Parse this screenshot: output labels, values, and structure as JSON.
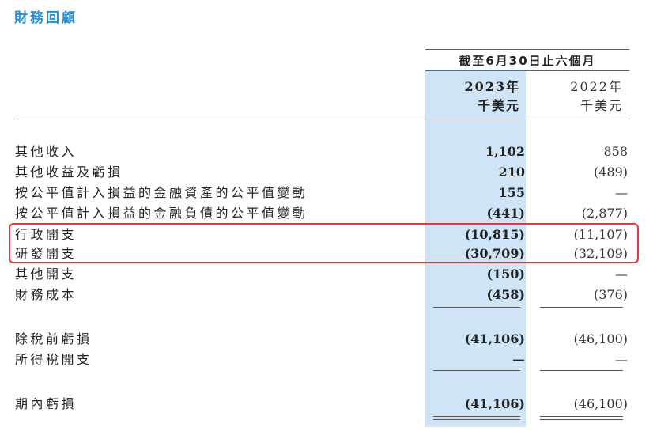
{
  "document": {
    "section_title": "財務回顧",
    "period_header": "截至6月30日止六個月",
    "columns": {
      "current": {
        "year": "2023年",
        "unit": "千美元"
      },
      "previous": {
        "year": "2022年",
        "unit": "千美元"
      }
    },
    "rows": [
      {
        "label": "其他收入",
        "current": "1,102",
        "previous": "858"
      },
      {
        "label": "其他收益及虧損",
        "current": "210",
        "previous": "(489)"
      },
      {
        "label": "按公平值計入損益的金融資產的公平值變動",
        "current": "155",
        "previous": "—"
      },
      {
        "label": "按公平值計入損益的金融負債的公平值變動",
        "current": "(441)",
        "previous": "(2,877)"
      },
      {
        "label": "行政開支",
        "current": "(10,815)",
        "previous": "(11,107)"
      },
      {
        "label": "研發開支",
        "current": "(30,709)",
        "previous": "(32,109)"
      },
      {
        "label": "其他開支",
        "current": "(150)",
        "previous": "—"
      },
      {
        "label": "財務成本",
        "current": "(458)",
        "previous": "(376)"
      },
      {
        "label": "除稅前虧損",
        "current": "(41,106)",
        "previous": "(46,100)"
      },
      {
        "label": "所得稅開支",
        "current": "—",
        "previous": "—"
      },
      {
        "label": "期內虧損",
        "current": "(41,106)",
        "previous": "(46,100)"
      }
    ],
    "highlighted_rows": [
      "行政開支",
      "研發開支"
    ],
    "colors": {
      "title_blue": "#2a8fd0",
      "column_band": "#cfe5f7",
      "highlight_red": "#e23b3b"
    }
  }
}
